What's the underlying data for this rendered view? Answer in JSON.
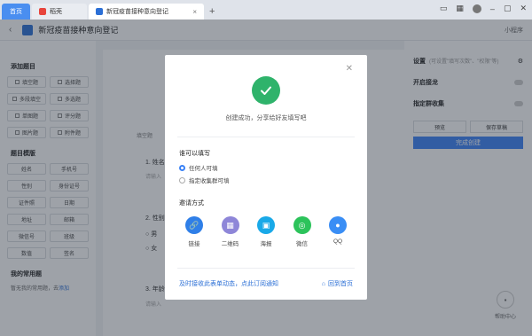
{
  "tabs": [
    {
      "label": "首页"
    },
    {
      "label": "稻壳"
    },
    {
      "label": "新冠疫苗接种意向登记"
    }
  ],
  "header": {
    "title": "新冠疫苗接种意向登记",
    "mini_program": "小程序"
  },
  "left": {
    "add_title": "添加题目",
    "questions": [
      "填空题",
      "选择题",
      "多段填空",
      "多选题",
      "单图题",
      "评分题",
      "图片题",
      "附件题"
    ],
    "template_title": "题目模版",
    "templates": [
      "姓名",
      "手机号",
      "性别",
      "身份证号",
      "证件照",
      "日期",
      "地址",
      "邮箱",
      "微信号",
      "班级",
      "数值",
      "签名"
    ],
    "common_title": "我的常用题",
    "common_empty": "暂无我的常用题，去",
    "common_link": "添加"
  },
  "canvas": {
    "tag": "填空题",
    "q1": "1. 姓名",
    "q1_hint": "请输入",
    "q2": "2. 性别",
    "q2_opt1": "男",
    "q2_opt2": "女",
    "q3": "3. 年龄",
    "q3_hint": "请输入"
  },
  "right": {
    "settings": "设置",
    "settings_hint": "(可设置\"填写次数\"、\"权限\"等)",
    "toggle1": "开启接龙",
    "toggle2": "指定群收集",
    "preview": "预览",
    "save_draft": "保存草稿",
    "publish": "完成创建"
  },
  "help": "帮助中心",
  "modal": {
    "success": "创建成功，分享给好友填写吧",
    "who_label": "谁可以填写",
    "option_anyone": "任何人可填",
    "option_group": "指定收集群可填",
    "invite_label": "邀请方式",
    "invites": [
      {
        "label": "链接",
        "color": "#2f7fe8",
        "icon": "link-icon"
      },
      {
        "label": "二维码",
        "color": "#8e86d8",
        "icon": "qrcode-icon"
      },
      {
        "label": "海报",
        "color": "#19a9e8",
        "icon": "poster-icon"
      },
      {
        "label": "微信",
        "color": "#2cc35b",
        "icon": "wechat-icon"
      },
      {
        "label": "QQ",
        "color": "#3a8ef5",
        "icon": "qq-icon"
      }
    ],
    "notify_link": "及时接收此表单动态，点此订阅通知",
    "back_home": "回到首页"
  }
}
